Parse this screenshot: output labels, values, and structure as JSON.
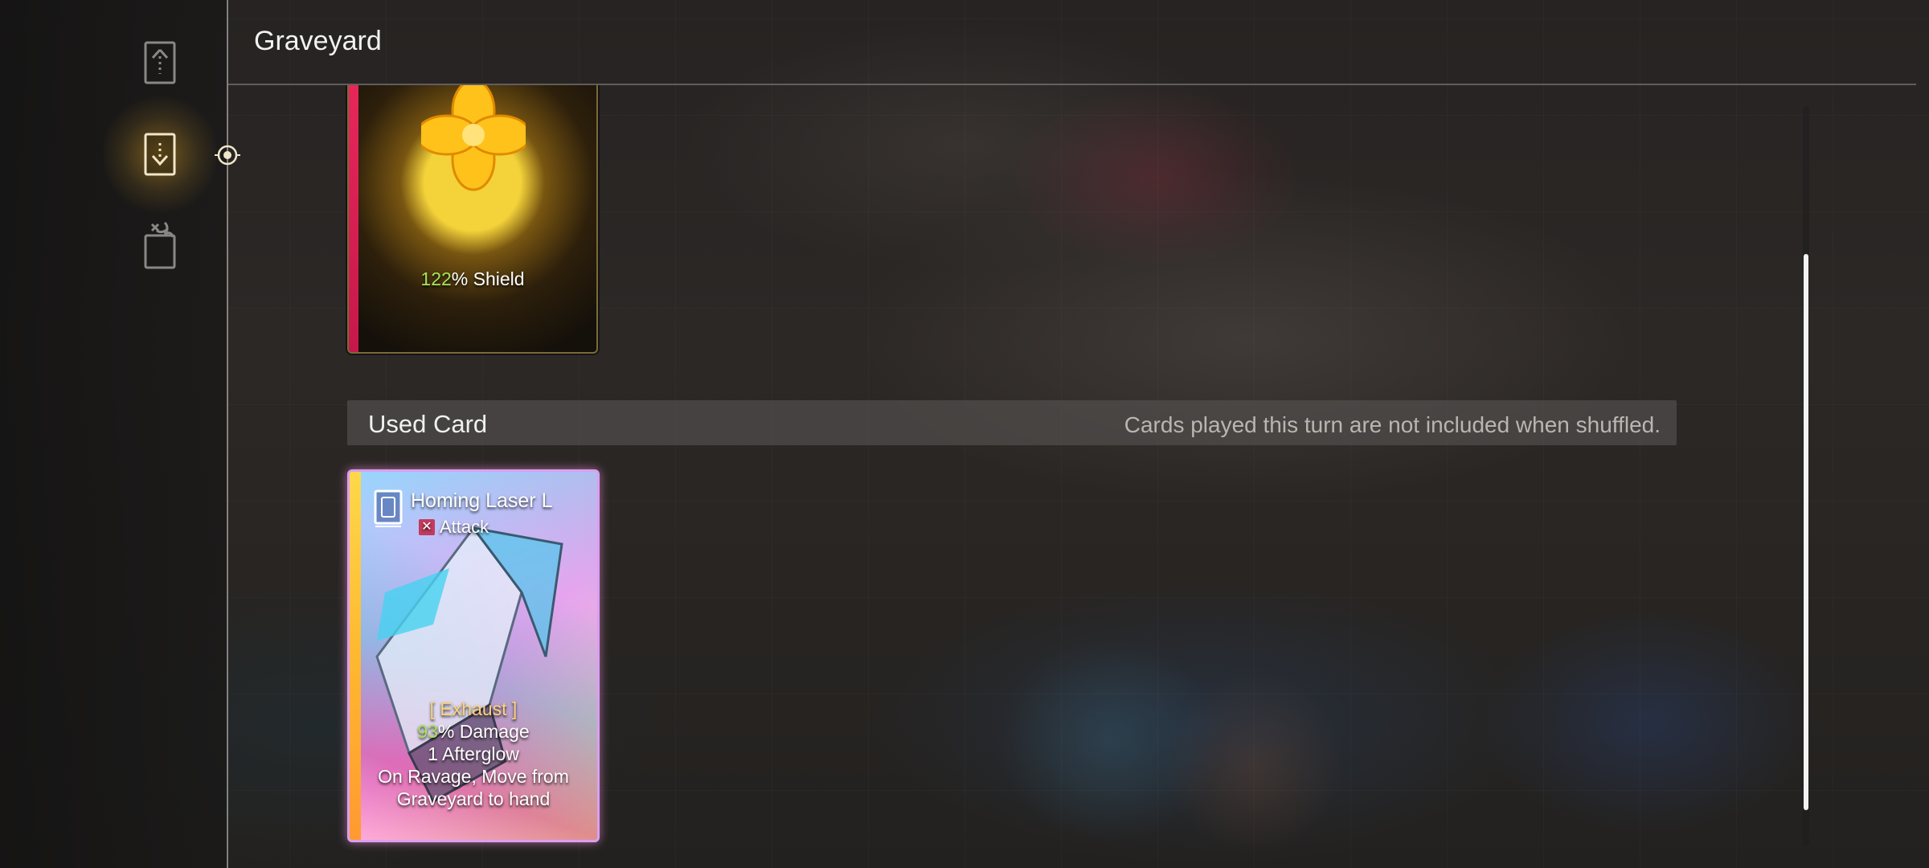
{
  "header": {
    "title": "Graveyard",
    "close_icon": "close-icon"
  },
  "sidebar": {
    "items": [
      {
        "icon": "draw-pile-icon",
        "active": false
      },
      {
        "icon": "graveyard-icon",
        "active": true
      },
      {
        "icon": "removed-cards-icon",
        "active": false
      }
    ]
  },
  "cards_top": [
    {
      "art": "golden-flower",
      "effect_value": "122",
      "effect_text": "% Shield",
      "stripe_color": "#e8275a"
    }
  ],
  "used_section": {
    "title": "Used Card",
    "note": "Cards played this turn are not included when shuffled."
  },
  "used_cards": [
    {
      "name": "Homing Laser L",
      "type": "Attack",
      "tag": "[ Exhaust ]",
      "damage_value": "93",
      "damage_text": "% Damage",
      "line3": "1 Afterglow",
      "line4": "On Ravage, Move from",
      "line5": "Graveyard to hand",
      "stripe_color": "#ffd84a"
    }
  ],
  "colors": {
    "accent_gold": "#e6aa28",
    "highlight_green": "#a6e35a",
    "attack_red": "#c23a5e"
  }
}
